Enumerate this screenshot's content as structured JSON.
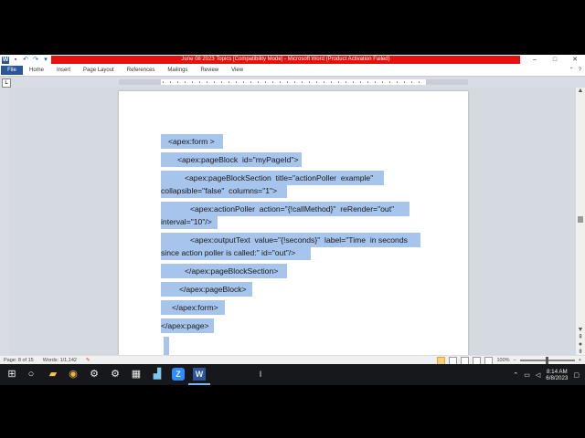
{
  "window": {
    "title": "June 08 2023 Topics [Compatibility Mode] - Microsoft Word (Product Activation Failed)",
    "controls": {
      "minimize": "–",
      "maximize": "□",
      "close": "✕"
    }
  },
  "menu": {
    "file": "File",
    "tabs": [
      "Home",
      "Insert",
      "Page Layout",
      "References",
      "Mailings",
      "Review",
      "View"
    ],
    "help": "?"
  },
  "document": {
    "lines": [
      "<apex:form >",
      "<apex:pageBlock  id=\"myPageId\">",
      "<apex:pageBlockSection  title=\"actionPoller  example\"",
      "collapsible=\"false\"  columns=\"1\">",
      "<apex:actionPoller  action=\"{!callMethod}\"  reRender=\"out\"",
      "interval=\"10\"/>",
      "<apex:outputText  value=\"{!seconds}\"  label=\"Time  in seconds",
      "since action poller is called:\" id=\"out\"/>",
      "</apex:pageBlockSection>",
      "</apex:pageBlock>",
      "</apex:form>",
      "</apex:page>"
    ]
  },
  "status": {
    "page": "Page: 8 of 15",
    "words": "Words: 1/1,142",
    "zoom": "100%",
    "zoom_level": 1.0
  },
  "taskbar": {
    "time": "8:14 AM",
    "date": "6/8/2023",
    "icons": [
      "windows-start",
      "search",
      "file-explorer",
      "chrome",
      "settings-gear",
      "gear",
      "calculator",
      "cleanup",
      "zoom",
      "word"
    ]
  },
  "colors": {
    "selection": "#a6c4ec",
    "title_bar": "#e8100c",
    "file_tab": "#2b579a",
    "taskbar": "#16181c"
  }
}
